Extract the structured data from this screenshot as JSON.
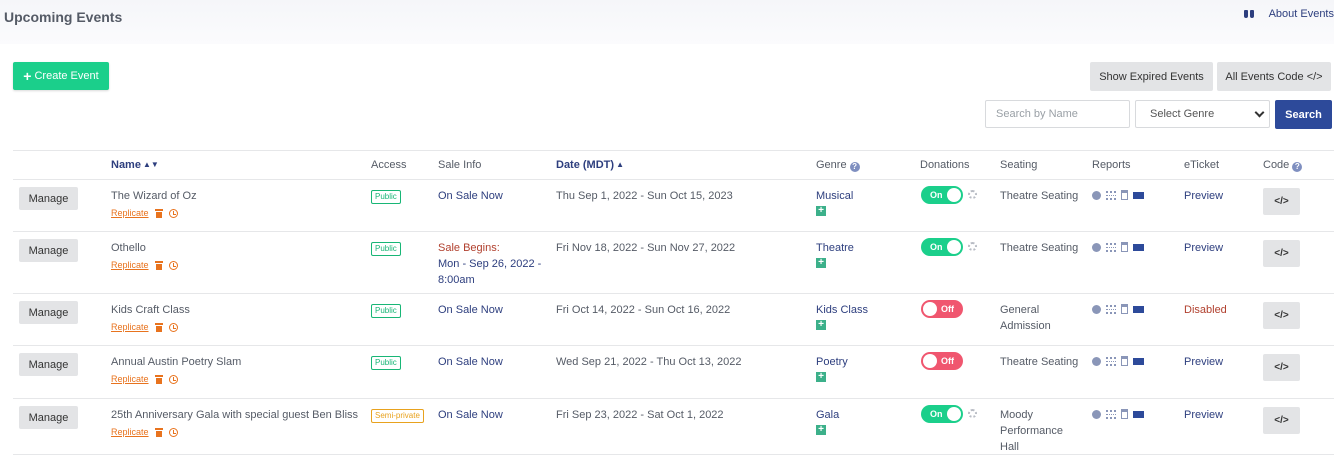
{
  "header": {
    "title": "Upcoming Events",
    "about_label": "About Events",
    "about_icon": "binoculars-icon"
  },
  "toolbar": {
    "create_label": "Create Event",
    "expired_label": "Show Expired Events",
    "all_code_label": "All Events Code </>",
    "search_placeholder": "Search by Name",
    "genre_select_value": "Select Genre",
    "search_label": "Search"
  },
  "table": {
    "columns": {
      "name": "Name",
      "access": "Access",
      "sale_info": "Sale Info",
      "date": "Date (MDT)",
      "genre": "Genre",
      "donations": "Donations",
      "seating": "Seating",
      "reports": "Reports",
      "eticket": "eTicket",
      "code": "Code"
    },
    "manage_label": "Manage",
    "replicate_label": "Replicate",
    "code_label": "</>",
    "rows": [
      {
        "name": "The Wizard of Oz",
        "access": "Public",
        "sale_status": "On Sale Now",
        "sale_begins_label": "",
        "sale_begins_date": "",
        "date": "Thu Sep 1, 2022 - Sun Oct 15, 2023",
        "genre": "Musical",
        "donations": "On",
        "seating": "Theatre Seating",
        "eticket": "Preview"
      },
      {
        "name": "Othello",
        "access": "Public",
        "sale_status": "",
        "sale_begins_label": "Sale Begins:",
        "sale_begins_date": "Mon - Sep 26, 2022 - 8:00am",
        "date": "Fri Nov 18, 2022 - Sun Nov 27, 2022",
        "genre": "Theatre",
        "donations": "On",
        "seating": "Theatre Seating",
        "eticket": "Preview"
      },
      {
        "name": "Kids Craft Class",
        "access": "Public",
        "sale_status": "On Sale Now",
        "sale_begins_label": "",
        "sale_begins_date": "",
        "date": "Fri Oct 14, 2022 - Sun Oct 16, 2022",
        "genre": "Kids Class",
        "donations": "Off",
        "seating": "General Admission",
        "eticket": "Disabled"
      },
      {
        "name": "Annual Austin Poetry Slam",
        "access": "Public",
        "sale_status": "On Sale Now",
        "sale_begins_label": "",
        "sale_begins_date": "",
        "date": "Wed Sep 21, 2022 - Thu Oct 13, 2022",
        "genre": "Poetry",
        "donations": "Off",
        "seating": "Theatre Seating",
        "eticket": "Preview"
      },
      {
        "name": "25th Anniversary Gala with special guest Ben Bliss",
        "access": "Semi-private",
        "sale_status": "On Sale Now",
        "sale_begins_label": "",
        "sale_begins_date": "",
        "date": "Fri Sep 23, 2022 - Sat Oct 1, 2022",
        "genre": "Gala",
        "donations": "On",
        "seating": "Moody Performance Hall",
        "eticket": "Preview"
      }
    ]
  }
}
